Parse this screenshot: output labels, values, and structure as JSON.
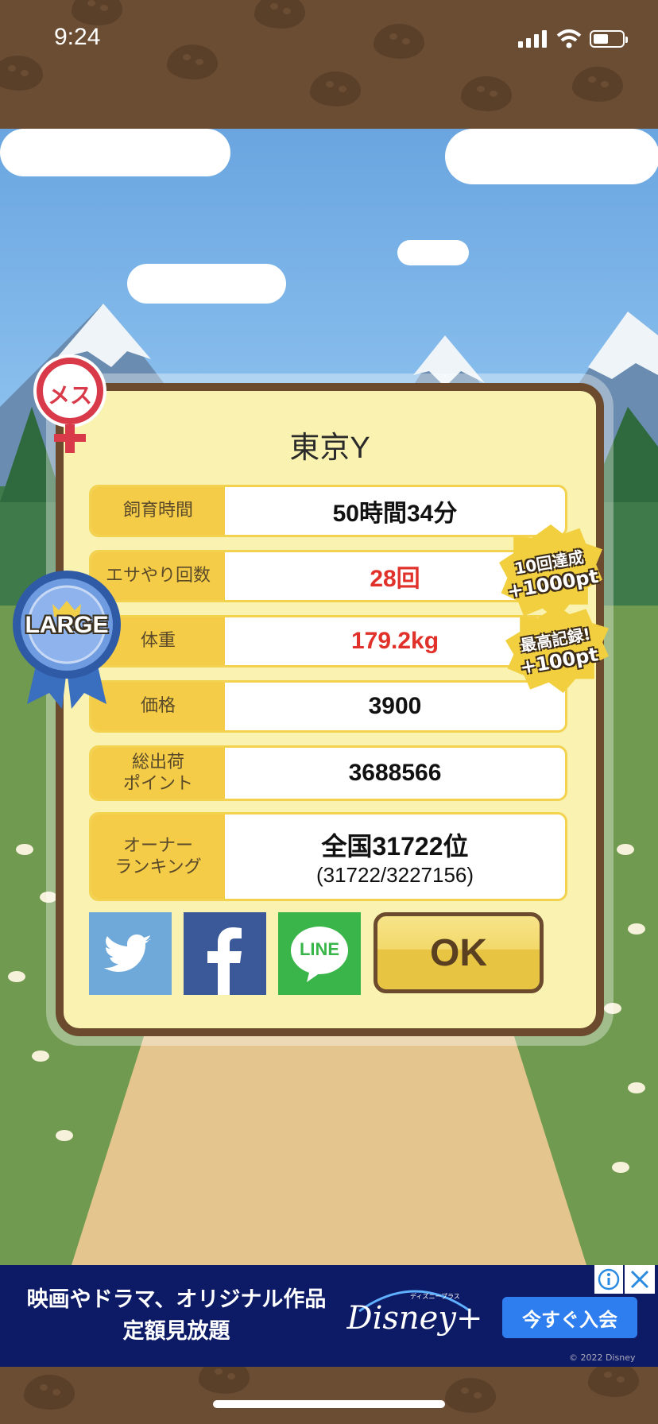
{
  "status_bar": {
    "time": "9:24"
  },
  "pet": {
    "gender_label": "メス",
    "size_badge": "LARGE",
    "name": "東京Y"
  },
  "stats": [
    {
      "label": "飼育時間",
      "value": "50時間34分",
      "highlight": false
    },
    {
      "label": "エサやり回数",
      "value": "28回",
      "highlight": true
    },
    {
      "label": "体重",
      "value": "179.2kg",
      "highlight": true
    },
    {
      "label": "価格",
      "value": "3900",
      "highlight": false
    },
    {
      "label": "総出荷\nポイント",
      "value": "3688566",
      "highlight": false
    }
  ],
  "ranking": {
    "label": "オーナー\nランキング",
    "main": "全国31722位",
    "sub": "(31722/3227156)"
  },
  "achievements": [
    {
      "line1": "10回達成",
      "line2": "+1000pt"
    },
    {
      "line1": "最高記録!",
      "line2": "+100pt"
    }
  ],
  "share": {
    "twitter_icon": "twitter-bird-icon",
    "facebook_icon": "facebook-f-icon",
    "line_label": "LINE"
  },
  "ok_label": "OK",
  "ad": {
    "text": "映画やドラマ、オリジナル作品\n定額見放題",
    "brand": "Disney+",
    "brand_sub": "ディズニープラス",
    "cta": "今すぐ入会",
    "copyright": "© 2022 Disney"
  },
  "colors": {
    "accent_red": "#e0312a",
    "label_yellow": "#f5cc48",
    "frame_brown": "#6b4a2e",
    "ad_bg": "#0d1a66"
  }
}
